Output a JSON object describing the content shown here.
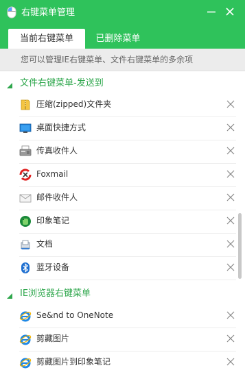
{
  "app": {
    "title": "右键菜单管理",
    "accent_color": "#2fc25b",
    "section_color": "#2fa74d",
    "title_icon": "mouse-icon"
  },
  "window_controls": [
    {
      "name": "minimize-button",
      "icon": "minimize-icon"
    },
    {
      "name": "close-button",
      "icon": "close-icon"
    }
  ],
  "tabs": [
    {
      "label": "当前右键菜单",
      "active": true
    },
    {
      "label": "已删除菜单",
      "active": false
    }
  ],
  "info": {
    "text": "您可以管理IE右键菜单、文件右键菜单的多余项"
  },
  "sections": [
    {
      "label": "文件右键菜单-发送到",
      "expanded": true,
      "items": [
        {
          "label": "压缩(zipped)文件夹",
          "icon": "zip-folder-icon"
        },
        {
          "label": "桌面快捷方式",
          "icon": "desktop-icon"
        },
        {
          "label": "传真收件人",
          "icon": "fax-icon"
        },
        {
          "label": "Foxmail",
          "icon": "foxmail-icon"
        },
        {
          "label": "邮件收件人",
          "icon": "mail-icon"
        },
        {
          "label": "印象笔记",
          "icon": "evernote-icon"
        },
        {
          "label": "文档",
          "icon": "documents-icon"
        },
        {
          "label": "蓝牙设备",
          "icon": "bluetooth-icon"
        }
      ]
    },
    {
      "label": "IE浏览器右键菜单",
      "expanded": true,
      "items": [
        {
          "label": "Se&nd to OneNote",
          "icon": "ie-icon"
        },
        {
          "label": "剪藏图片",
          "icon": "ie-icon"
        },
        {
          "label": "剪藏图片到印象笔记",
          "icon": "ie-icon"
        }
      ]
    }
  ],
  "row_action": {
    "icon": "delete-x-icon"
  }
}
